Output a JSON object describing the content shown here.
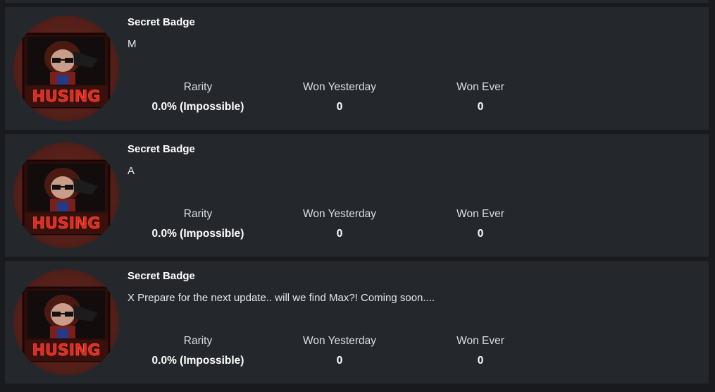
{
  "badges": [
    {
      "name": "Secret Badge",
      "description": "M",
      "image_caption": "HUSING",
      "stats": {
        "rarity_label": "Rarity",
        "rarity_value": "0.0% (Impossible)",
        "won_yesterday_label": "Won Yesterday",
        "won_yesterday_value": "0",
        "won_ever_label": "Won Ever",
        "won_ever_value": "0"
      }
    },
    {
      "name": "Secret Badge",
      "description": "A",
      "image_caption": "HUSING",
      "stats": {
        "rarity_label": "Rarity",
        "rarity_value": "0.0% (Impossible)",
        "won_yesterday_label": "Won Yesterday",
        "won_yesterday_value": "0",
        "won_ever_label": "Won Ever",
        "won_ever_value": "0"
      }
    },
    {
      "name": "Secret Badge",
      "description": "X Prepare for the next update.. will we find Max?! Coming soon....",
      "image_caption": "HUSING",
      "stats": {
        "rarity_label": "Rarity",
        "rarity_value": "0.0% (Impossible)",
        "won_yesterday_label": "Won Yesterday",
        "won_yesterday_value": "0",
        "won_ever_label": "Won Ever",
        "won_ever_value": "0"
      }
    }
  ],
  "colors": {
    "page_background": "#191a1d",
    "card_background": "#24272c",
    "primary_text": "#ffffff",
    "secondary_text": "#dcdee2",
    "badge_accent": "#d42a22"
  }
}
